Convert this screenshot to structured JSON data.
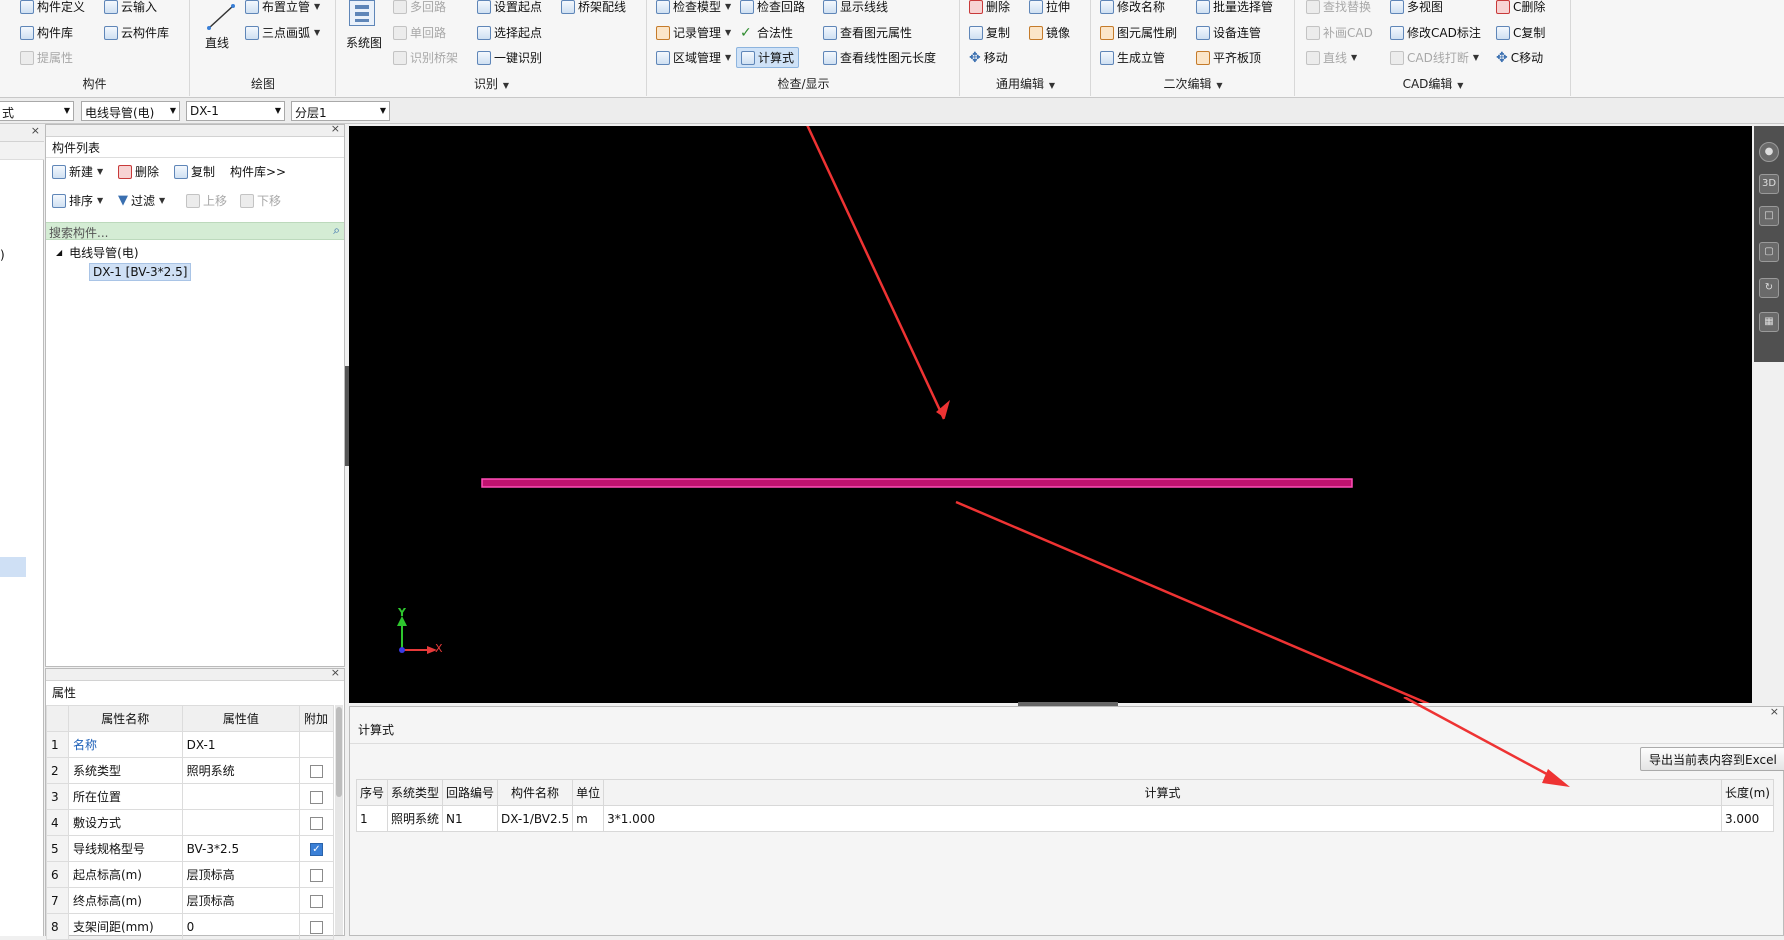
{
  "ribbon": {
    "groups": {
      "component": {
        "title": "构件",
        "items": [
          "构件定义",
          "云输入",
          "构件库",
          "云构件库",
          "提属性"
        ]
      },
      "draw": {
        "title": "绘图",
        "items": [
          "直线",
          "布置立管",
          "三点画弧"
        ]
      },
      "identify": {
        "title": "识别",
        "items": [
          "系统图",
          "多回路",
          "设置起点",
          "桥架配线",
          "单回路",
          "选择起点",
          "识别桥架",
          "一键识别"
        ]
      },
      "check": {
        "title": "检查/显示",
        "items": [
          "检查模型",
          "检查回路",
          "显示线线",
          "记录管理",
          "合法性",
          "查看图元属性",
          "区域管理",
          "计算式",
          "查看线性图元长度"
        ]
      },
      "edit": {
        "title": "通用编辑",
        "items": [
          "删除",
          "拉伸",
          "复制",
          "镜像",
          "移动"
        ]
      },
      "secondary": {
        "title": "二次编辑",
        "items": [
          "修改名称",
          "批量选择管",
          "图元属性刷",
          "设备连管",
          "生成立管",
          "平齐板顶"
        ]
      },
      "cad": {
        "title": "CAD编辑",
        "items": [
          "查找替换",
          "多视图",
          "C删除",
          "补画CAD",
          "修改CAD标注",
          "C复制",
          "直线",
          "CAD线打断",
          "C移动"
        ]
      }
    }
  },
  "toolbar2": {
    "combo0": "式",
    "combo1": "电线导管(电)",
    "combo2": "DX-1",
    "combo3": "分层1"
  },
  "component_panel": {
    "title": "构件列表",
    "new": "新建",
    "delete": "删除",
    "copy": "复制",
    "library": "构件库>>",
    "sort": "排序",
    "filter": "过滤",
    "up": "上移",
    "down": "下移",
    "search_placeholder": "搜索构件...",
    "tree_parent": "电线导管(电)",
    "tree_child": "DX-1 [BV-3*2.5]",
    "left_strip_char": ")"
  },
  "properties": {
    "title": "属性",
    "headers": [
      "属性名称",
      "属性值",
      "附加"
    ],
    "rows": [
      {
        "n": "1",
        "name": "名称",
        "value": "DX-1",
        "checked": false,
        "has_check": false
      },
      {
        "n": "2",
        "name": "系统类型",
        "value": "照明系统",
        "checked": false,
        "has_check": true
      },
      {
        "n": "3",
        "name": "所在位置",
        "value": "",
        "checked": false,
        "has_check": true
      },
      {
        "n": "4",
        "name": "敷设方式",
        "value": "",
        "checked": false,
        "has_check": true
      },
      {
        "n": "5",
        "name": "导线规格型号",
        "value": "BV-3*2.5",
        "checked": true,
        "has_check": true
      },
      {
        "n": "6",
        "name": "起点标高(m)",
        "value": "层顶标高",
        "checked": false,
        "has_check": true
      },
      {
        "n": "7",
        "name": "终点标高(m)",
        "value": "层顶标高",
        "checked": false,
        "has_check": true
      },
      {
        "n": "8",
        "name": "支架间距(mm)",
        "value": "0",
        "checked": false,
        "has_check": true
      }
    ]
  },
  "canvas": {
    "axis_y": "Y",
    "axis_x": "X",
    "line_color": "#e0188c",
    "arrow_color": "#ee3333"
  },
  "calc_panel": {
    "title": "计算式",
    "export_button": "导出当前表内容到Excel",
    "headers": [
      "序号",
      "系统类型",
      "回路编号",
      "构件名称",
      "单位",
      "计算式",
      "长度(m)"
    ],
    "row": [
      "1",
      "照明系统",
      "N1",
      "DX-1/BV2.5",
      "m",
      "3*1.000",
      "3.000"
    ]
  }
}
